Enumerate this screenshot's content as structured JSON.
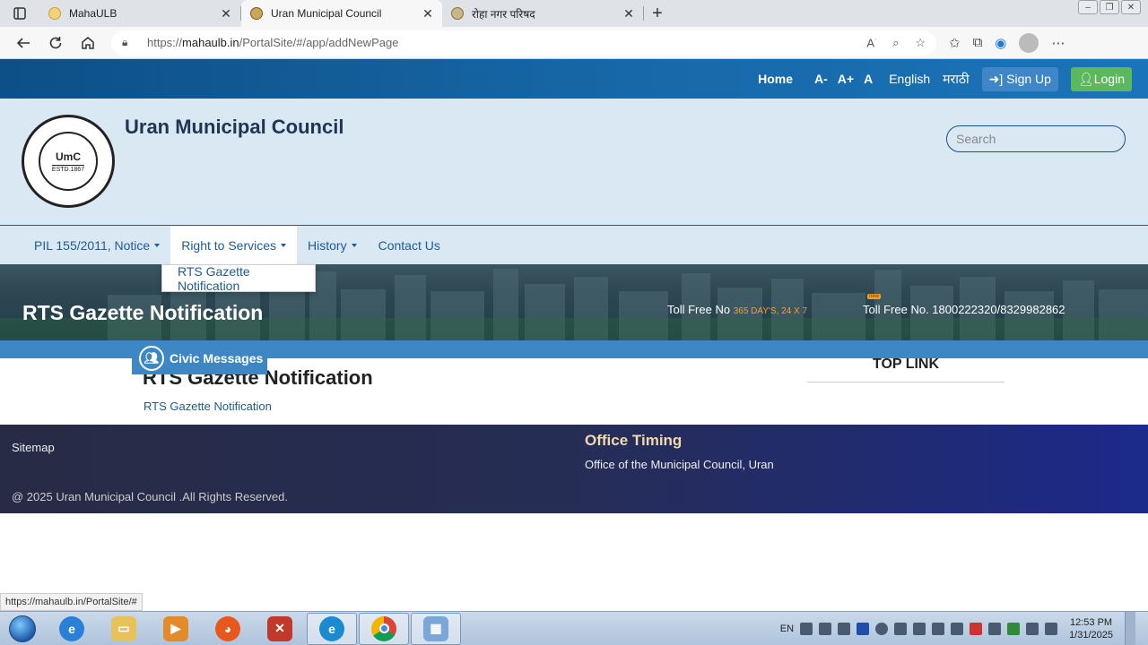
{
  "browser": {
    "tabs": [
      {
        "title": "MahaULB",
        "active": false
      },
      {
        "title": "Uran Municipal Council",
        "active": true
      },
      {
        "title": "रोहा नगर परिषद",
        "active": false
      }
    ],
    "url_prefix": "https://",
    "url_domain": "mahaulb.in",
    "url_path": "/PortalSite/#/app/addNewPage",
    "status_url": "https://mahaulb.in/PortalSite/#"
  },
  "topbar": {
    "home": "Home",
    "font_minus": "A-",
    "font_plus": "A+",
    "font_normal": "A",
    "english": "English",
    "marathi": "मराठी",
    "signup": "Sign Up",
    "login": "Login"
  },
  "brand": {
    "title": "Uran Municipal Council",
    "logo_text": "UmC",
    "logo_estd": "ESTD.1867",
    "search_placeholder": "Search"
  },
  "nav": {
    "items": [
      {
        "label": "PIL 155/2011, Notice",
        "dropdown": true
      },
      {
        "label": "Right to Services",
        "dropdown": true
      },
      {
        "label": "History",
        "dropdown": true
      },
      {
        "label": "Contact Us",
        "dropdown": false
      }
    ],
    "open_menu_item": "RTS Gazette Notification"
  },
  "banner": {
    "title": "RTS Gazette Notification",
    "tollfree_label": "Toll Free No",
    "tollfree_sub": "365 DAY'S, 24 X 7",
    "new_badge": "new",
    "tollfree2": "Toll Free No. 1800222320/8329982862"
  },
  "civic": {
    "label": "Civic Messages"
  },
  "content": {
    "heading": "RTS Gazette Notification",
    "link": "RTS Gazette Notification",
    "toplink": "TOP LINK"
  },
  "footer": {
    "sitemap": "Sitemap",
    "copyright": "@ 2025 Uran Municipal Council .All Rights Reserved.",
    "office_heading": "Office Timing",
    "office_text": "Office of the Municipal Council, Uran"
  },
  "taskbar": {
    "lang": "EN",
    "time": "12:53 PM",
    "date": "1/31/2025"
  },
  "colors": {
    "topbar": "#1768a8",
    "brand_bg": "#d9e8f3",
    "link": "#1f5a95",
    "login": "#5cb85c",
    "stripe": "#3d87c5"
  }
}
